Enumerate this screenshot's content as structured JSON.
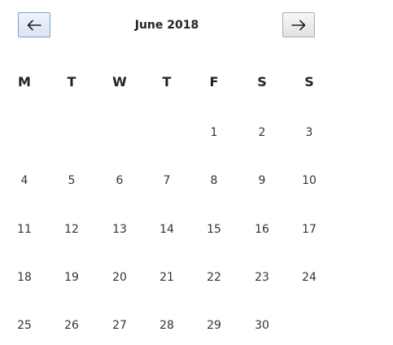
{
  "header": {
    "title": "June 2018",
    "prev_icon": "arrow-left-icon",
    "next_icon": "arrow-right-icon"
  },
  "weekdays": [
    "M",
    "T",
    "W",
    "T",
    "F",
    "S",
    "S"
  ],
  "weeks": [
    [
      "",
      "",
      "",
      "",
      "1",
      "2",
      "3"
    ],
    [
      "4",
      "5",
      "6",
      "7",
      "8",
      "9",
      "10"
    ],
    [
      "11",
      "12",
      "13",
      "14",
      "15",
      "16",
      "17"
    ],
    [
      "18",
      "19",
      "20",
      "21",
      "22",
      "23",
      "24"
    ],
    [
      "25",
      "26",
      "27",
      "28",
      "29",
      "30",
      ""
    ]
  ],
  "colors": {
    "text": "#222222",
    "prev_button_border": "#7da2ce",
    "next_button_border": "#adadad"
  }
}
